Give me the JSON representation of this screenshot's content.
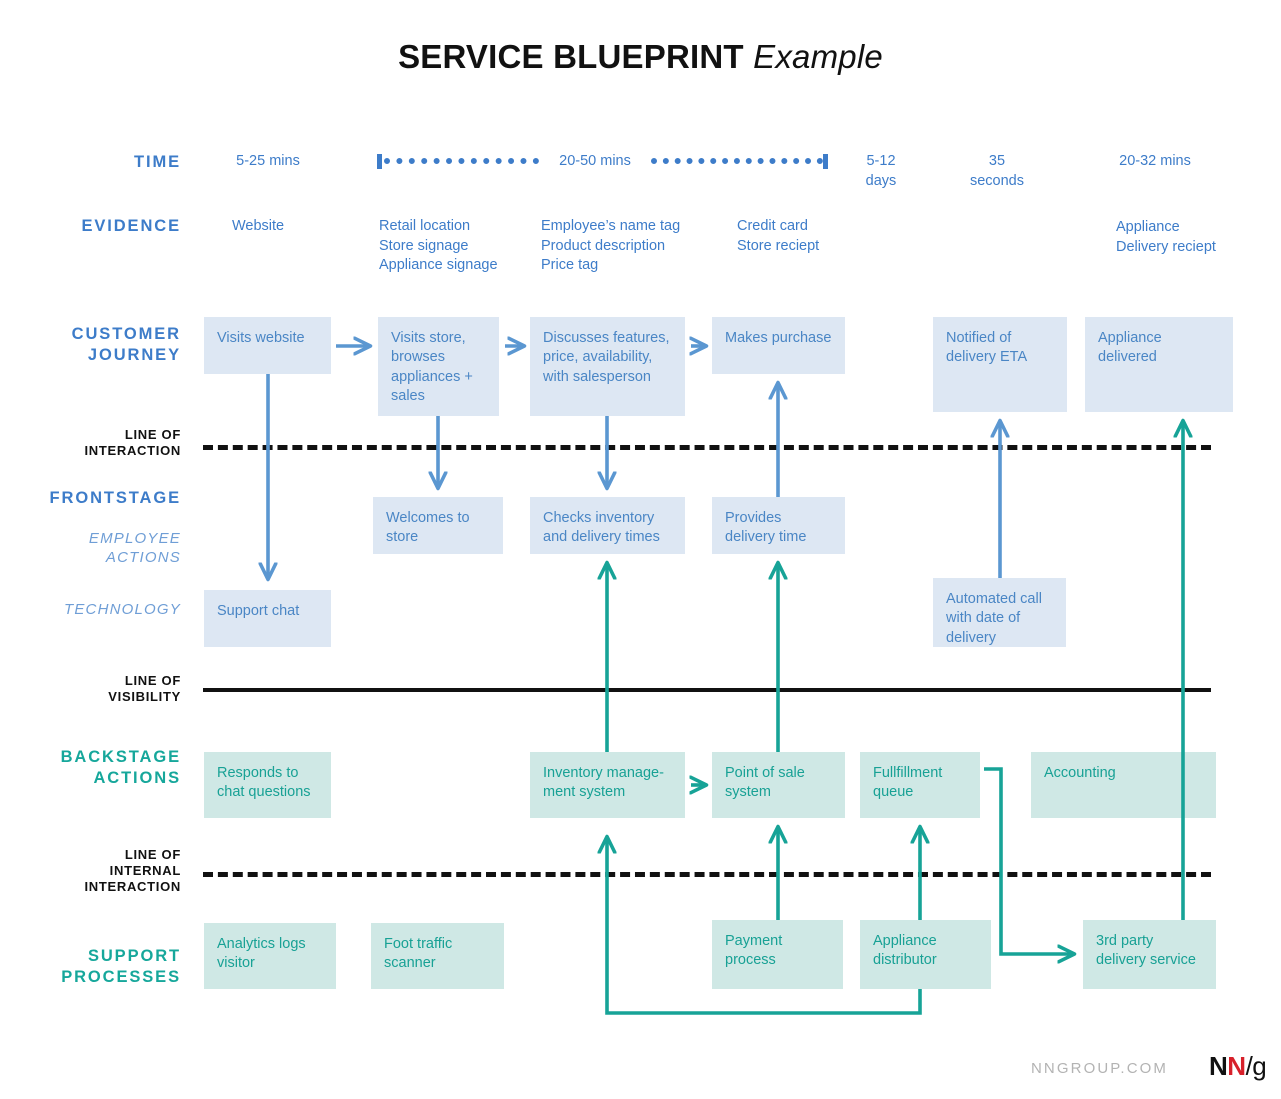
{
  "title": {
    "bold": "SERVICE BLUEPRINT",
    "italic": "Example"
  },
  "colors": {
    "blue_accent": "#3d7cc9",
    "blue_box_fill": "#dde7f3",
    "blue_box_text": "#4a86c5",
    "teal_accent": "#16a79b",
    "teal_box_fill": "#cfe8e5",
    "teal_box_text": "#18a195",
    "line_black": "#111111",
    "footer_grey": "#b3b3b3",
    "logo_red": "#d7202a"
  },
  "row_labels": {
    "time": "TIME",
    "evidence": "EVIDENCE",
    "customer_journey": "CUSTOMER\nJOURNEY",
    "customer_journey_l1": "CUSTOMER",
    "customer_journey_l2": "JOURNEY",
    "line_of_interaction_l1": "LINE OF",
    "line_of_interaction_l2": "INTERACTION",
    "frontstage": "FRONTSTAGE",
    "employee_actions_l1": "EMPLOYEE",
    "employee_actions_l2": "ACTIONS",
    "technology": "TECHNOLOGY",
    "line_of_visibility_l1": "LINE OF",
    "line_of_visibility_l2": "VISIBILITY",
    "backstage_l1": "BACKSTAGE",
    "backstage_l2": "ACTIONS",
    "line_of_internal_l1": "LINE OF",
    "line_of_internal_l2": "INTERNAL",
    "line_of_internal_l3": "INTERACTION",
    "support_l1": "SUPPORT",
    "support_l2": "PROCESSES"
  },
  "time_row": {
    "c1": "5-25 mins",
    "c2_span": "20-50 mins",
    "c3_l1": "5-12",
    "c3_l2": "days",
    "c4_l1": "35",
    "c4_l2": "seconds",
    "c5": "20-32 mins"
  },
  "evidence_row": {
    "c1": "Website",
    "c2_l1": "Retail location",
    "c2_l2": "Store signage",
    "c2_l3": "Appliance signage",
    "c3_l1": "Employee’s name tag",
    "c3_l2": "Product description",
    "c3_l3": "Price tag",
    "c4_l1": "Credit card",
    "c4_l2": "Store reciept",
    "c5_l1": "Appliance",
    "c5_l2": "Delivery reciept"
  },
  "customer_journey": [
    {
      "text": "Visits website"
    },
    {
      "text": "Visits store, browses appliances + sales"
    },
    {
      "text": "Discusses features, price, availability, with salesperson"
    },
    {
      "text": "Makes purchase"
    },
    {
      "text": "Notified of delivery ETA"
    },
    {
      "text": "Appliance delivered"
    }
  ],
  "frontstage_employee": [
    {
      "text": "Welcomes to store"
    },
    {
      "text": "Checks inventory and delivery times"
    },
    {
      "text": "Provides delivery time"
    }
  ],
  "frontstage_technology": [
    {
      "text": "Support chat"
    },
    {
      "text": "Automated call with date of delivery"
    }
  ],
  "backstage_actions": [
    {
      "text": "Responds to chat questions"
    },
    {
      "text": "Inventory manage-ment system"
    },
    {
      "text": "Point of sale system"
    },
    {
      "text": "Fullfillment queue"
    },
    {
      "text": "Accounting"
    }
  ],
  "support_processes": [
    {
      "text": "Analytics logs visitor"
    },
    {
      "text": "Foot traffic scanner"
    },
    {
      "text": "Payment process"
    },
    {
      "text": "Appliance distributor"
    },
    {
      "text": "3rd party delivery service"
    }
  ],
  "footer": {
    "url": "NNGROUP.COM",
    "logo_n1": "N",
    "logo_n2": "N",
    "logo_slash": "/g"
  }
}
